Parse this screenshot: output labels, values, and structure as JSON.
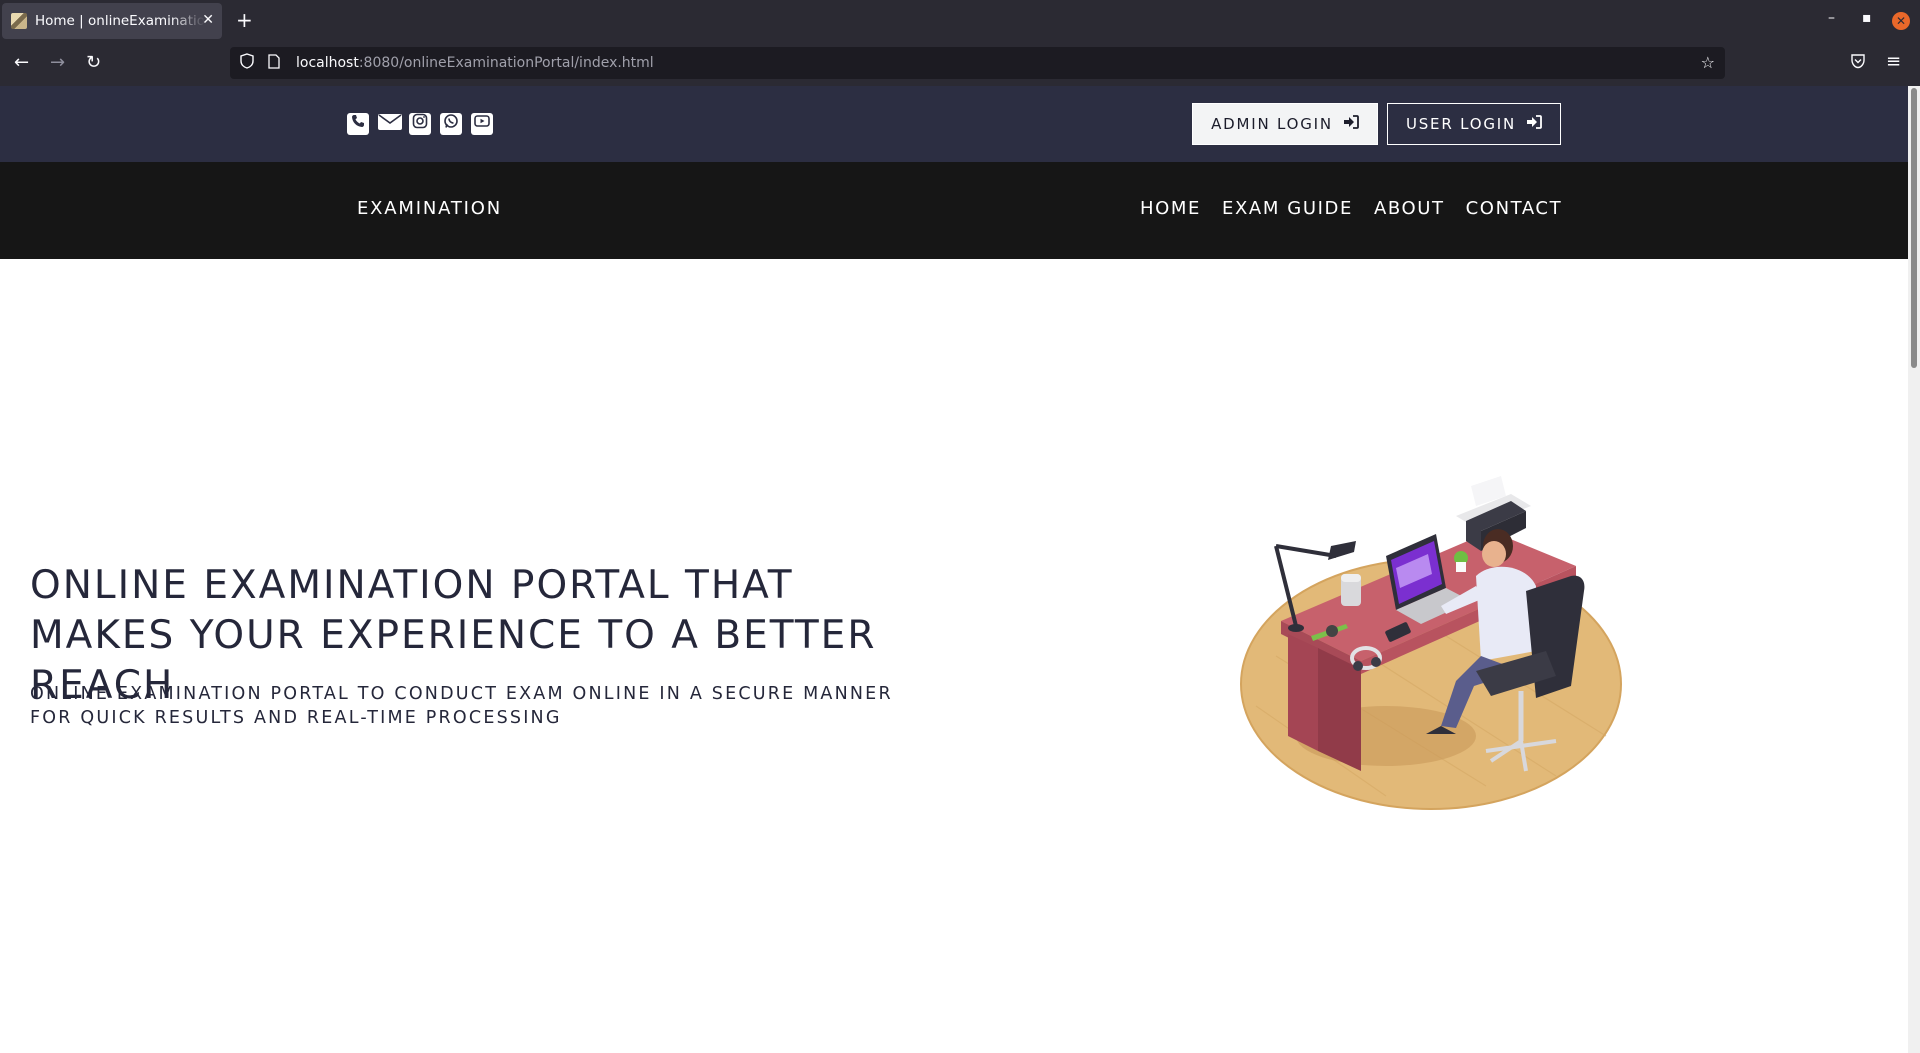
{
  "browser": {
    "tab_title": "Home | onlineExaminationPortal",
    "url_host": "localhost",
    "url_rest": ":8080/onlineExaminationPortal/index.html",
    "icons": [
      "back-icon",
      "forward-icon",
      "reload-icon",
      "shield-icon",
      "page-icon",
      "star-icon",
      "pocket-icon",
      "menu-icon"
    ]
  },
  "topbar": {
    "social_icons": [
      "phone-icon",
      "envelope-icon",
      "instagram-icon",
      "whatsapp-icon",
      "youtube-icon"
    ],
    "admin_login": "ADMIN LOGIN",
    "user_login": "USER LOGIN"
  },
  "nav": {
    "brand": "EXAMINATION",
    "items": [
      "HOME",
      "EXAM GUIDE",
      "ABOUT",
      "CONTACT"
    ]
  },
  "hero": {
    "title": "ONLINE EXAMINATION PORTAL THAT MAKES YOUR EXPERIENCE TO A BETTER REACH",
    "subtitle": "ONLINE EXAMINATION PORTAL TO CONDUCT EXAM ONLINE IN A SECURE MANNER FOR QUICK RESULTS AND REAL-TIME PROCESSING"
  },
  "colors": {
    "topstrip": "#2c2e42",
    "nav": "#161616",
    "heading": "#25273a"
  }
}
